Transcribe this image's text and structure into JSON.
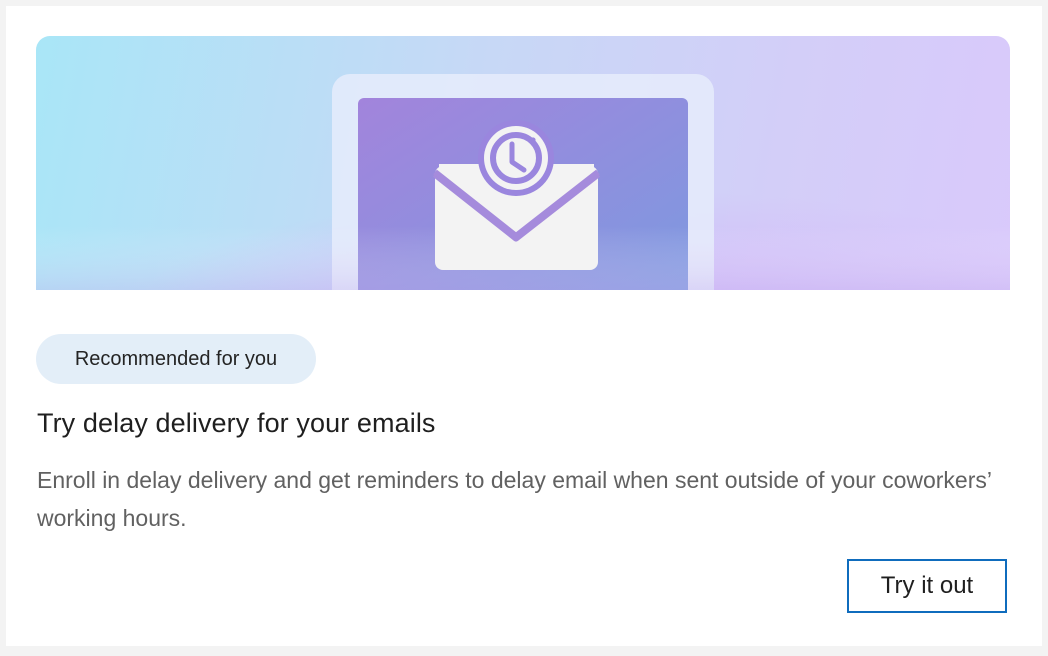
{
  "card": {
    "badge": "Recommended for you",
    "title": "Try delay delivery for your emails",
    "description": "Enroll in delay delivery and get reminders to delay email when sent outside of your coworkers’ working hours.",
    "cta_label": "Try it out"
  },
  "hero_illustration": {
    "icons": [
      "envelope-icon",
      "clock-icon"
    ]
  },
  "colors": {
    "accent": "#0f6cbd",
    "badge_bg": "#e3eef8",
    "illustration_purple": "#9a86de"
  }
}
